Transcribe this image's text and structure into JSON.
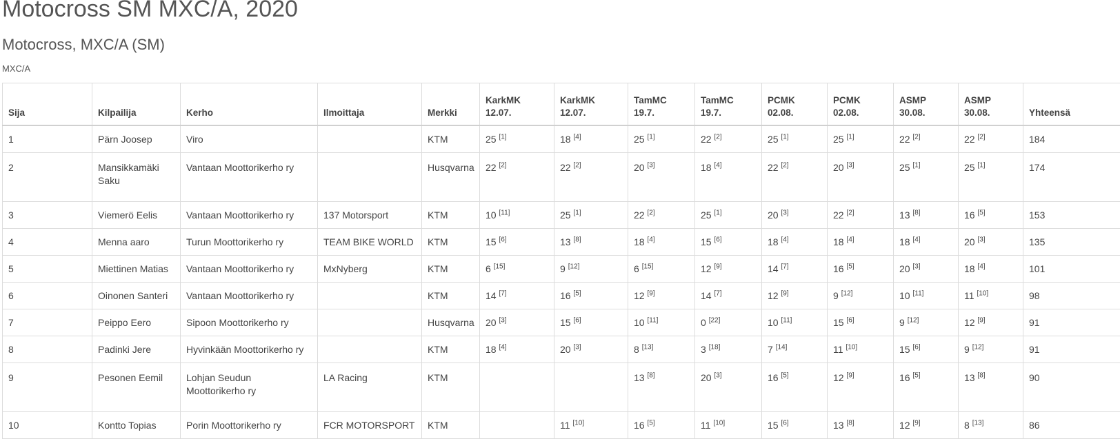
{
  "page": {
    "title": "Motocross SM MXC/A, 2020",
    "subtitle": "Motocross, MXC/A (SM)",
    "class_label": "MXC/A"
  },
  "table": {
    "headers": {
      "sija": "Sija",
      "kilpailija": "Kilpailija",
      "kerho": "Kerho",
      "ilmoittaja": "Ilmoittaja",
      "merkki": "Merkki",
      "yhteensa": "Yhteensä"
    },
    "races": [
      {
        "name": "KarkMK",
        "date": "12.07."
      },
      {
        "name": "KarkMK",
        "date": "12.07."
      },
      {
        "name": "TamMC",
        "date": "19.7."
      },
      {
        "name": "TamMC",
        "date": "19.7."
      },
      {
        "name": "PCMK",
        "date": "02.08."
      },
      {
        "name": "PCMK",
        "date": "02.08."
      },
      {
        "name": "ASMP",
        "date": "30.08."
      },
      {
        "name": "ASMP",
        "date": "30.08."
      }
    ],
    "rows": [
      {
        "sija": "1",
        "kilpailija": "Pärn Joosep",
        "kerho": "Viro",
        "ilmoittaja": "",
        "merkki": "KTM",
        "results": [
          {
            "p": "25",
            "r": "[1]"
          },
          {
            "p": "18",
            "r": "[4]"
          },
          {
            "p": "25",
            "r": "[1]"
          },
          {
            "p": "22",
            "r": "[2]"
          },
          {
            "p": "25",
            "r": "[1]"
          },
          {
            "p": "25",
            "r": "[1]"
          },
          {
            "p": "22",
            "r": "[2]"
          },
          {
            "p": "22",
            "r": "[2]"
          }
        ],
        "yhteensa": "184"
      },
      {
        "sija": "2",
        "kilpailija": "Mansikkamäki Saku",
        "kerho": "Vantaan Moottorikerho ry",
        "ilmoittaja": "",
        "merkki": "Husqvarna",
        "results": [
          {
            "p": "22",
            "r": "[2]"
          },
          {
            "p": "22",
            "r": "[2]"
          },
          {
            "p": "20",
            "r": "[3]"
          },
          {
            "p": "18",
            "r": "[4]"
          },
          {
            "p": "22",
            "r": "[2]"
          },
          {
            "p": "20",
            "r": "[3]"
          },
          {
            "p": "25",
            "r": "[1]"
          },
          {
            "p": "25",
            "r": "[1]"
          }
        ],
        "yhteensa": "174"
      },
      {
        "sija": "3",
        "kilpailija": "Viemerö Eelis",
        "kerho": "Vantaan Moottorikerho ry",
        "ilmoittaja": "137 Motorsport",
        "merkki": "KTM",
        "results": [
          {
            "p": "10",
            "r": "[11]"
          },
          {
            "p": "25",
            "r": "[1]"
          },
          {
            "p": "22",
            "r": "[2]"
          },
          {
            "p": "25",
            "r": "[1]"
          },
          {
            "p": "20",
            "r": "[3]"
          },
          {
            "p": "22",
            "r": "[2]"
          },
          {
            "p": "13",
            "r": "[8]"
          },
          {
            "p": "16",
            "r": "[5]"
          }
        ],
        "yhteensa": "153"
      },
      {
        "sija": "4",
        "kilpailija": "Menna aaro",
        "kerho": "Turun Moottorikerho ry",
        "ilmoittaja": "TEAM BIKE WORLD",
        "merkki": "KTM",
        "results": [
          {
            "p": "15",
            "r": "[6]"
          },
          {
            "p": "13",
            "r": "[8]"
          },
          {
            "p": "18",
            "r": "[4]"
          },
          {
            "p": "15",
            "r": "[6]"
          },
          {
            "p": "18",
            "r": "[4]"
          },
          {
            "p": "18",
            "r": "[4]"
          },
          {
            "p": "18",
            "r": "[4]"
          },
          {
            "p": "20",
            "r": "[3]"
          }
        ],
        "yhteensa": "135"
      },
      {
        "sija": "5",
        "kilpailija": "Miettinen Matias",
        "kerho": "Vantaan Moottorikerho ry",
        "ilmoittaja": "MxNyberg",
        "merkki": "KTM",
        "results": [
          {
            "p": "6",
            "r": "[15]"
          },
          {
            "p": "9",
            "r": "[12]"
          },
          {
            "p": "6",
            "r": "[15]"
          },
          {
            "p": "12",
            "r": "[9]"
          },
          {
            "p": "14",
            "r": "[7]"
          },
          {
            "p": "16",
            "r": "[5]"
          },
          {
            "p": "20",
            "r": "[3]"
          },
          {
            "p": "18",
            "r": "[4]"
          }
        ],
        "yhteensa": "101"
      },
      {
        "sija": "6",
        "kilpailija": "Oinonen Santeri",
        "kerho": "Vantaan Moottorikerho ry",
        "ilmoittaja": "",
        "merkki": "KTM",
        "results": [
          {
            "p": "14",
            "r": "[7]"
          },
          {
            "p": "16",
            "r": "[5]"
          },
          {
            "p": "12",
            "r": "[9]"
          },
          {
            "p": "14",
            "r": "[7]"
          },
          {
            "p": "12",
            "r": "[9]"
          },
          {
            "p": "9",
            "r": "[12]"
          },
          {
            "p": "10",
            "r": "[11]"
          },
          {
            "p": "11",
            "r": "[10]"
          }
        ],
        "yhteensa": "98"
      },
      {
        "sija": "7",
        "kilpailija": "Peippo Eero",
        "kerho": "Sipoon Moottorikerho ry",
        "ilmoittaja": "",
        "merkki": "Husqvarna",
        "results": [
          {
            "p": "20",
            "r": "[3]"
          },
          {
            "p": "15",
            "r": "[6]"
          },
          {
            "p": "10",
            "r": "[11]"
          },
          {
            "p": "0",
            "r": "[22]"
          },
          {
            "p": "10",
            "r": "[11]"
          },
          {
            "p": "15",
            "r": "[6]"
          },
          {
            "p": "9",
            "r": "[12]"
          },
          {
            "p": "12",
            "r": "[9]"
          }
        ],
        "yhteensa": "91"
      },
      {
        "sija": "8",
        "kilpailija": "Padinki Jere",
        "kerho": "Hyvinkään Moottorikerho ry",
        "ilmoittaja": "",
        "merkki": "KTM",
        "results": [
          {
            "p": "18",
            "r": "[4]"
          },
          {
            "p": "20",
            "r": "[3]"
          },
          {
            "p": "8",
            "r": "[13]"
          },
          {
            "p": "3",
            "r": "[18]"
          },
          {
            "p": "7",
            "r": "[14]"
          },
          {
            "p": "11",
            "r": "[10]"
          },
          {
            "p": "15",
            "r": "[6]"
          },
          {
            "p": "9",
            "r": "[12]"
          }
        ],
        "yhteensa": "91"
      },
      {
        "sija": "9",
        "kilpailija": "Pesonen Eemil",
        "kerho": "Lohjan Seudun Moottorikerho ry",
        "ilmoittaja": "LA Racing",
        "merkki": "KTM",
        "results": [
          {
            "p": "",
            "r": ""
          },
          {
            "p": "",
            "r": ""
          },
          {
            "p": "13",
            "r": "[8]"
          },
          {
            "p": "20",
            "r": "[3]"
          },
          {
            "p": "16",
            "r": "[5]"
          },
          {
            "p": "12",
            "r": "[9]"
          },
          {
            "p": "16",
            "r": "[5]"
          },
          {
            "p": "13",
            "r": "[8]"
          }
        ],
        "yhteensa": "90"
      },
      {
        "sija": "10",
        "kilpailija": "Kontto Topias",
        "kerho": "Porin Moottorikerho ry",
        "ilmoittaja": "FCR MOTORSPORT",
        "merkki": "KTM",
        "results": [
          {
            "p": "",
            "r": ""
          },
          {
            "p": "11",
            "r": "[10]"
          },
          {
            "p": "16",
            "r": "[5]"
          },
          {
            "p": "11",
            "r": "[10]"
          },
          {
            "p": "15",
            "r": "[6]"
          },
          {
            "p": "13",
            "r": "[8]"
          },
          {
            "p": "12",
            "r": "[9]"
          },
          {
            "p": "8",
            "r": "[13]"
          }
        ],
        "yhteensa": "86"
      }
    ]
  }
}
